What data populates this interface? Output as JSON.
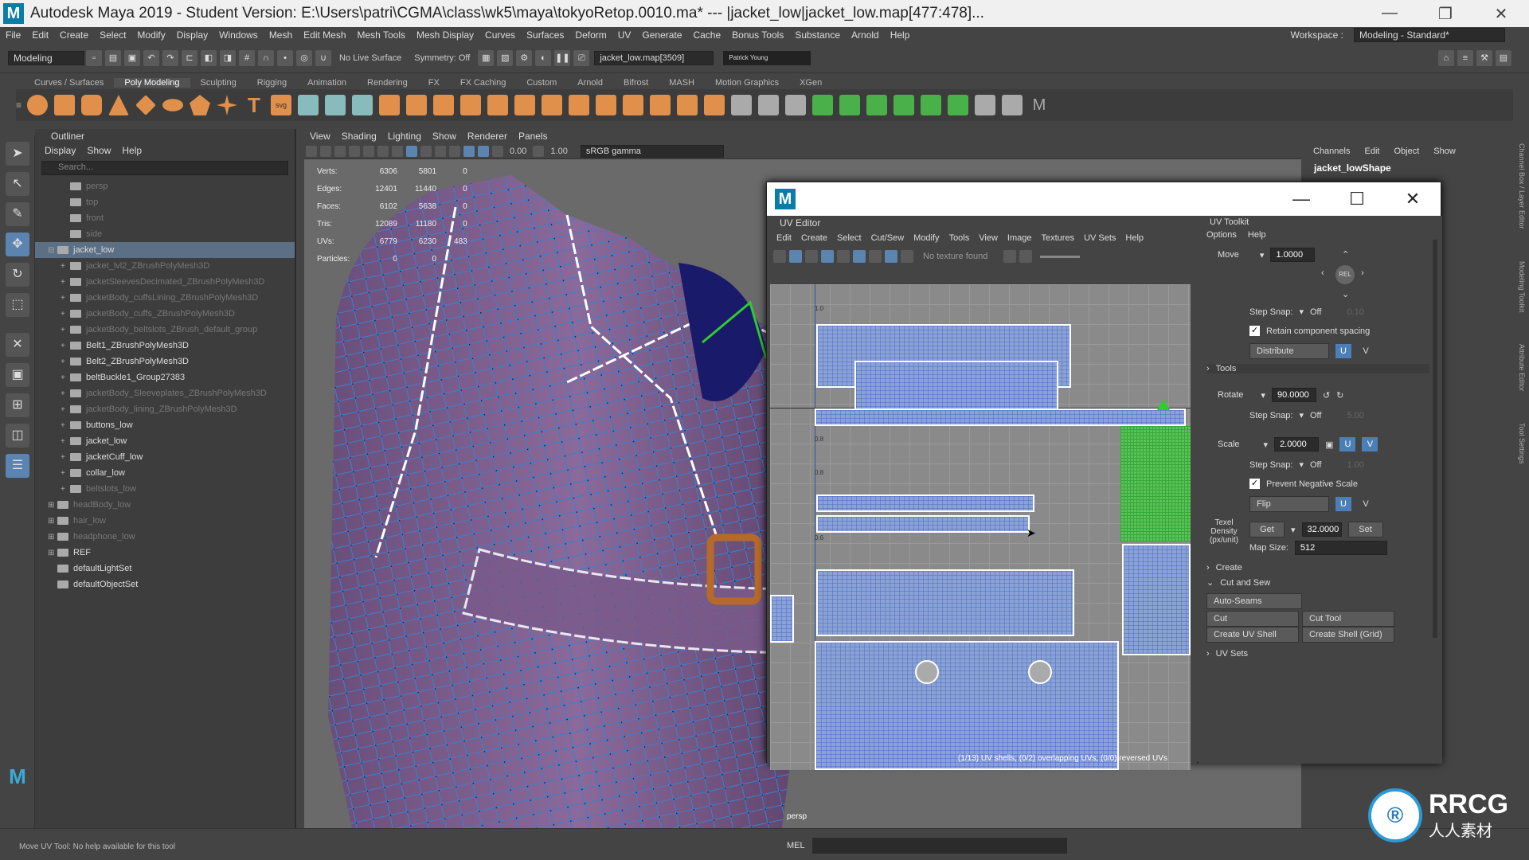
{
  "title": {
    "app": "Autodesk Maya 2019 - Student Version: E:\\Users\\patri\\CGMA\\class\\wk5\\maya\\tokyoRetop.0010.ma*   ---   |jacket_low|jacket_low.map[477:478]..."
  },
  "menubar": [
    "File",
    "Edit",
    "Create",
    "Select",
    "Modify",
    "Display",
    "Windows",
    "Mesh",
    "Edit Mesh",
    "Mesh Tools",
    "Mesh Display",
    "Curves",
    "Surfaces",
    "Deform",
    "UV",
    "Generate",
    "Cache",
    "Bonus Tools",
    "Substance",
    "Arnold",
    "Help"
  ],
  "workspace": {
    "label": "Workspace :",
    "value": "Modeling - Standard*"
  },
  "statusline": {
    "mode": "Modeling",
    "live": "No Live Surface",
    "symmetry": "Symmetry: Off",
    "selection": "jacket_low.map[3509]",
    "user": "Patrick Young"
  },
  "shelftabs": [
    "Curves / Surfaces",
    "Poly Modeling",
    "Sculpting",
    "Rigging",
    "Animation",
    "Rendering",
    "FX",
    "FX Caching",
    "Custom",
    "Arnold",
    "Bifrost",
    "MASH",
    "Motion Graphics",
    "XGen"
  ],
  "shelf_active": "Poly Modeling",
  "outliner": {
    "title": "Outliner",
    "menus": [
      "Display",
      "Show",
      "Help"
    ],
    "search": "Search...",
    "items": [
      {
        "label": "persp",
        "indent": 1,
        "dim": true,
        "exp": ""
      },
      {
        "label": "top",
        "indent": 1,
        "dim": true,
        "exp": ""
      },
      {
        "label": "front",
        "indent": 1,
        "dim": true,
        "exp": ""
      },
      {
        "label": "side",
        "indent": 1,
        "dim": true,
        "exp": ""
      },
      {
        "label": "jacket_low",
        "indent": 0,
        "sel": true,
        "exp": "⊟"
      },
      {
        "label": "jacket_lvl2_ZBrushPolyMesh3D",
        "indent": 1,
        "dim": true,
        "exp": "+"
      },
      {
        "label": "jacketSleevesDecimated_ZBrushPolyMesh3D",
        "indent": 1,
        "dim": true,
        "exp": "+"
      },
      {
        "label": "jacketBody_cuffsLining_ZBrushPolyMesh3D",
        "indent": 1,
        "dim": true,
        "exp": "+"
      },
      {
        "label": "jacketBody_cuffs_ZBrushPolyMesh3D",
        "indent": 1,
        "dim": true,
        "exp": "+"
      },
      {
        "label": "jacketBody_beltslots_ZBrush_default_group",
        "indent": 1,
        "dim": true,
        "exp": "+"
      },
      {
        "label": "Belt1_ZBrushPolyMesh3D",
        "indent": 1,
        "exp": "+"
      },
      {
        "label": "Belt2_ZBrushPolyMesh3D",
        "indent": 1,
        "exp": "+"
      },
      {
        "label": "beltBuckle1_Group27383",
        "indent": 1,
        "exp": "+"
      },
      {
        "label": "jacketBody_Sleeveplates_ZBrushPolyMesh3D",
        "indent": 1,
        "dim": true,
        "exp": "+"
      },
      {
        "label": "jacketBody_lining_ZBrushPolyMesh3D",
        "indent": 1,
        "dim": true,
        "exp": "+"
      },
      {
        "label": "buttons_low",
        "indent": 1,
        "exp": "+"
      },
      {
        "label": "jacket_low",
        "indent": 1,
        "exp": "+"
      },
      {
        "label": "jacketCuff_low",
        "indent": 1,
        "exp": "+"
      },
      {
        "label": "collar_low",
        "indent": 1,
        "exp": "+"
      },
      {
        "label": "beltslots_low",
        "indent": 1,
        "dim": true,
        "exp": "+"
      },
      {
        "label": "headBody_low",
        "indent": 0,
        "dim": true,
        "exp": "⊞"
      },
      {
        "label": "hair_low",
        "indent": 0,
        "dim": true,
        "exp": "⊞"
      },
      {
        "label": "headphone_low",
        "indent": 0,
        "dim": true,
        "exp": "⊞"
      },
      {
        "label": "REF",
        "indent": 0,
        "exp": "⊞"
      },
      {
        "label": "defaultLightSet",
        "indent": 0,
        "exp": ""
      },
      {
        "label": "defaultObjectSet",
        "indent": 0,
        "exp": ""
      }
    ]
  },
  "viewport": {
    "menus": [
      "View",
      "Shading",
      "Lighting",
      "Show",
      "Renderer",
      "Panels"
    ],
    "val1": "0.00",
    "val2": "1.00",
    "colorspace": "sRGB gamma",
    "camera": "persp",
    "hud": [
      [
        "Verts:",
        "6306",
        "5801",
        "0"
      ],
      [
        "Edges:",
        "12401",
        "11440",
        "0"
      ],
      [
        "Faces:",
        "6102",
        "5638",
        "0"
      ],
      [
        "Tris:",
        "12089",
        "11180",
        "0"
      ],
      [
        "UVs:",
        "6779",
        "6230",
        "483"
      ],
      [
        "Particles:",
        "0",
        "0",
        ""
      ]
    ]
  },
  "channelbox": {
    "menus": [
      "Channels",
      "Edit",
      "Object",
      "Show"
    ],
    "object": "jacket_lowShape",
    "sidetabs": [
      "Channel Box / Layer Editor",
      "Modeling Toolkit",
      "Attribute Editor",
      "Tool Settings"
    ]
  },
  "uveditor": {
    "title": "UV Editor",
    "menus": [
      "Edit",
      "Create",
      "Select",
      "Cut/Sew",
      "Modify",
      "Tools",
      "View",
      "Image",
      "Textures",
      "UV Sets",
      "Help"
    ],
    "texture": "No texture found",
    "status": "(1/13) UV shells, (0/2) overlapping UVs, (0/0) reversed UVs",
    "ticks": [
      "1.0",
      "0.8",
      "0.8",
      "0.6"
    ]
  },
  "uvtoolkit": {
    "title": "UV Toolkit",
    "menus": [
      "Options",
      "Help"
    ],
    "move": {
      "label": "Move",
      "value": "1.0000",
      "center": "REL"
    },
    "stepsnap_label": "Step Snap:",
    "stepsnap_value": "Off",
    "stepsnap_num1": "0.10",
    "stepsnap_num2": "5.00",
    "stepsnap_num3": "1.00",
    "retain": "Retain component spacing",
    "distribute": "Distribute",
    "u": "U",
    "v": "V",
    "tools": "Tools",
    "rotate": {
      "label": "Rotate",
      "value": "90.0000"
    },
    "scale": {
      "label": "Scale",
      "value": "2.0000"
    },
    "prevent": "Prevent Negative Scale",
    "flip": "Flip",
    "texel": {
      "label": "Texel Density (px/unit)",
      "get": "Get",
      "value": "32.0000",
      "set": "Set",
      "mapsize_label": "Map Size:",
      "mapsize": "512"
    },
    "sections": {
      "create": "Create",
      "cutsew": "Cut and Sew",
      "uvsets": "UV Sets"
    },
    "autoseams": "Auto-Seams",
    "cut": "Cut",
    "cuttool": "Cut Tool",
    "createuvshell": "Create UV Shell",
    "createshellgrid": "Create Shell (Grid)"
  },
  "helpline": "Move UV Tool: No help available for this tool",
  "cmd": {
    "mel": "MEL"
  },
  "watermark": {
    "brand": "RRCG",
    "sub": "人人素材"
  },
  "colors": {
    "jacket": "#7a5a8a",
    "wire": "#3a7fd0",
    "uvshell": "#8aa2d4",
    "uvselected": "#5cc05c",
    "accent": "#4a7fb8"
  }
}
